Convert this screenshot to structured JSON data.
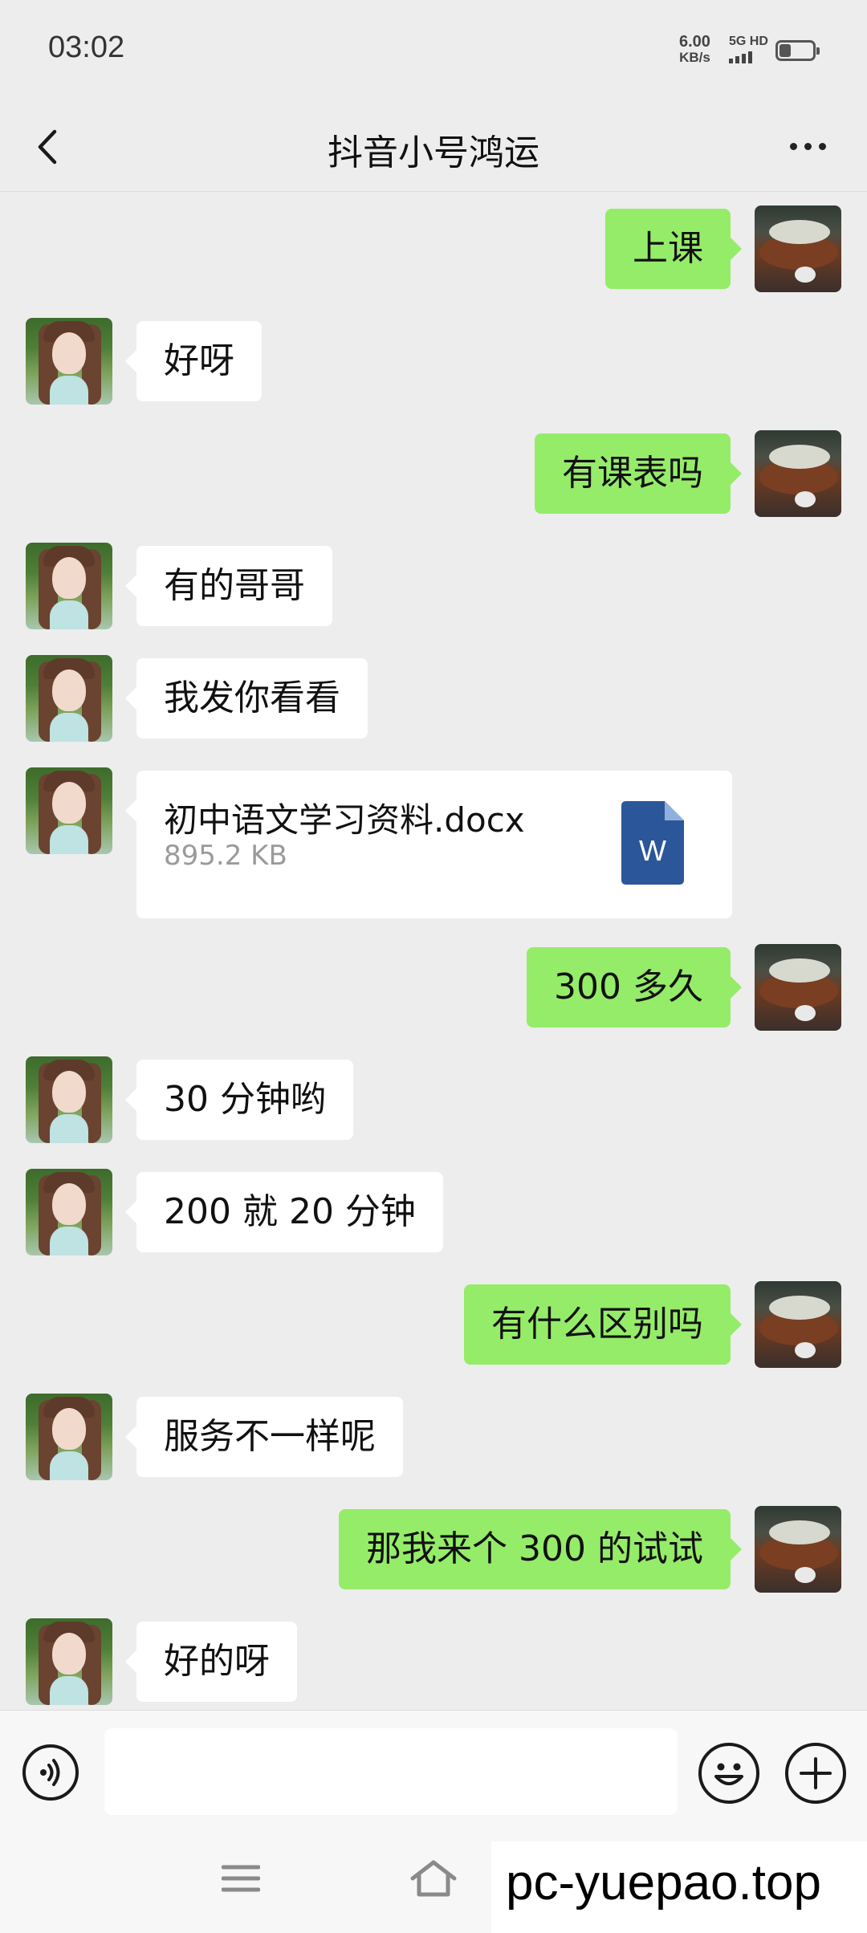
{
  "status_bar": {
    "time": "03:02",
    "net_speed_value": "6.00",
    "net_speed_unit": "KB/s",
    "signal_label": "5G HD"
  },
  "header": {
    "title": "抖音小号鸿运"
  },
  "messages": [
    {
      "side": "out",
      "text": "上课"
    },
    {
      "side": "in",
      "text": "好呀"
    },
    {
      "side": "out",
      "text": "有课表吗"
    },
    {
      "side": "in",
      "text": "有的哥哥"
    },
    {
      "side": "in",
      "text": "我发你看看"
    },
    {
      "side": "in",
      "type": "file",
      "file_name": "初中语文学习资料.docx",
      "file_size": "895.2 KB",
      "file_icon_letter": "W"
    },
    {
      "side": "out",
      "text": "300 多久"
    },
    {
      "side": "in",
      "text": "30 分钟哟"
    },
    {
      "side": "in",
      "text": "200 就 20 分钟"
    },
    {
      "side": "out",
      "text": "有什么区别吗"
    },
    {
      "side": "in",
      "text": "服务不一样呢"
    },
    {
      "side": "out",
      "text": "那我来个 300 的试试"
    },
    {
      "side": "in",
      "text": "好的呀"
    }
  ],
  "input_bar": {
    "placeholder": ""
  },
  "watermark": {
    "text": "pc-yuepao.top"
  },
  "colors": {
    "background": "#ededed",
    "outgoing_bubble": "#95ec69",
    "incoming_bubble": "#ffffff",
    "doc_icon": "#2b579a"
  }
}
